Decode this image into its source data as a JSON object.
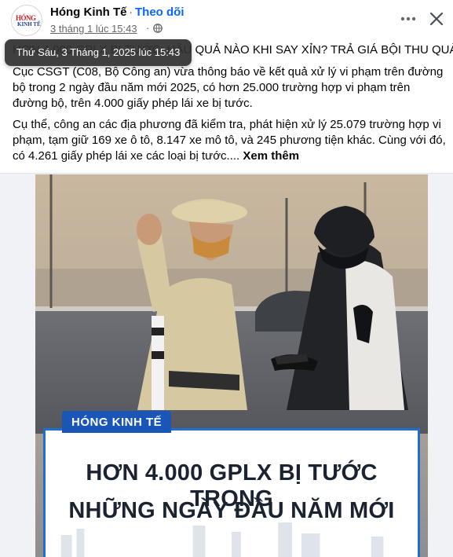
{
  "page": {
    "name": "Hóng Kinh Tế",
    "separator": "·",
    "follow_label": "Theo dõi",
    "timestamp": "3 tháng 1 lúc 15:43",
    "timestamp_separator": "·",
    "tooltip": "Thứ Sáu, 3 Tháng 1, 2025 lúc 15:43",
    "avatar_top": "HÓNG",
    "avatar_bottom": "KINH TẾ"
  },
  "post": {
    "title_visible": "HƠN 4.000 GPLX BỊ TƯỚC: HẬU QUẢ NÀO KHI SAY XỈN? TRẢ GIÁ BỘI THU QUẢ !",
    "paragraph1": "Cục CSGT (C08, Bộ Công an) vừa thông báo về kết quả xử lý vi phạm trên đường bộ trong 2 ngày đầu năm mới 2025, có hơn 25.000 trường hợp vi phạm trên đường bộ, trên 4.000 giấy phép lái xe bị tước.",
    "paragraph2": "Cụ thể, công an các địa phương đã kiểm tra, phát hiện xử lý 25.079 trường hợp vi phạm, tạm giữ 169 xe ô tô, 8.147 xe mô tô, và 245 phương tiện khác. Cùng với đó, có 4.261 giấy phép lái xe các loại bị tước....",
    "see_more": "Xem thêm"
  },
  "image": {
    "brand_banner": "HÓNG KINH TẾ",
    "headline_line1": "HƠN 4.000 GPLX BỊ TƯỚC TRONG",
    "headline_line2": "NHỮNG NGÀY ĐẦU NĂM MỚI"
  },
  "icons": {
    "more": "more-horizontal-icon",
    "close": "close-icon",
    "audience": "globe-icon"
  },
  "colors": {
    "link_blue": "#0866ff",
    "secondary_text": "#65676b",
    "banner_blue": "#1a55b8"
  }
}
